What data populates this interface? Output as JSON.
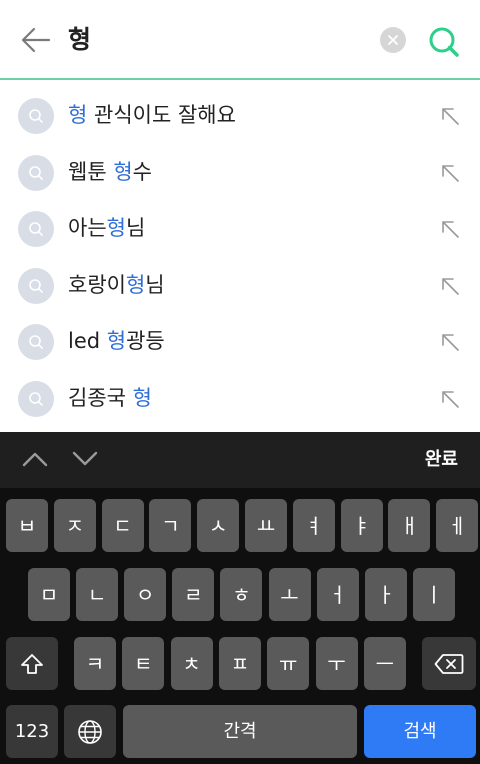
{
  "search": {
    "query": "형",
    "back_icon": "arrow-left-icon",
    "clear_icon": "close-icon",
    "search_icon": "search-icon",
    "accent_color": "#6fd0a3"
  },
  "suggestions": [
    {
      "pre": "",
      "hl": "형",
      "post": " 관식이도 잘해요"
    },
    {
      "pre": "웹툰 ",
      "hl": "형",
      "post": "수"
    },
    {
      "pre": "아는",
      "hl": "형",
      "post": "님"
    },
    {
      "pre": "호랑이",
      "hl": "형",
      "post": "님"
    },
    {
      "pre": "led ",
      "hl": "형",
      "post": "광등"
    },
    {
      "pre": "김종국 ",
      "hl": "형",
      "post": ""
    }
  ],
  "highlight_color": "#2f6fd8",
  "keyboard_toolbar": {
    "done_label": "완료"
  },
  "keyboard": {
    "row1": [
      "ㅂ",
      "ㅈ",
      "ㄷ",
      "ㄱ",
      "ㅅ",
      "ㅛ",
      "ㅕ",
      "ㅑ",
      "ㅐ",
      "ㅔ"
    ],
    "row2": [
      "ㅁ",
      "ㄴ",
      "ㅇ",
      "ㄹ",
      "ㅎ",
      "ㅗ",
      "ㅓ",
      "ㅏ",
      "ㅣ"
    ],
    "row3": [
      "ㅋ",
      "ㅌ",
      "ㅊ",
      "ㅍ",
      "ㅠ",
      "ㅜ",
      "ㅡ"
    ],
    "numbers_label": "123",
    "space_label": "간격",
    "search_label": "검색",
    "search_key_color": "#2f7af5"
  }
}
